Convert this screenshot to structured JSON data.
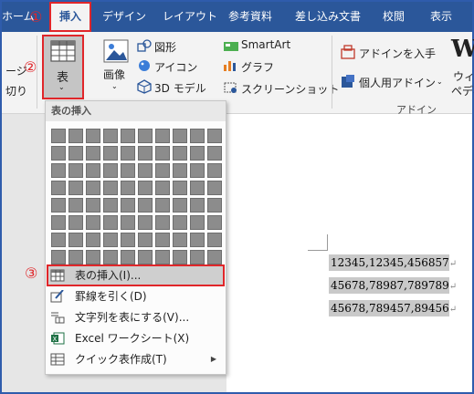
{
  "tabs": [
    {
      "label": "ホーム"
    },
    {
      "label": "挿入",
      "active": true
    },
    {
      "label": "デザイン"
    },
    {
      "label": "レイアウト"
    },
    {
      "label": "参考資料"
    },
    {
      "label": "差し込み文書"
    },
    {
      "label": "校閲"
    },
    {
      "label": "表示"
    }
  ],
  "markers": {
    "one": "①",
    "two": "②",
    "three": "③"
  },
  "ribbon": {
    "left_partial_1": "ージ",
    "left_partial_2": "切り",
    "table_label": "表",
    "image_label": "画像",
    "shapes_label": "図形",
    "icons_label": "アイコン",
    "model3d_label": "3D モデル",
    "smartart_label": "SmartArt",
    "graph_label": "グラフ",
    "screenshot_label": "スクリーンショット",
    "addin_get_label": "アドインを入手",
    "personal_addin_label": "個人用アドイン",
    "wiki_label_1": "ウィキ",
    "wiki_label_2": "ペディ",
    "addins_group_label": "アドイン",
    "wiki_logo": "W"
  },
  "dropdown": {
    "header": "表の挿入",
    "grid_rows": 8,
    "grid_cols": 10,
    "items": [
      {
        "label": "表の挿入(I)...",
        "icon": "table-icon"
      },
      {
        "label": "罫線を引く(D)",
        "icon": "draw-table-icon"
      },
      {
        "label": "文字列を表にする(V)...",
        "icon": "convert-text-icon"
      },
      {
        "label": "Excel ワークシート(X)",
        "icon": "excel-icon"
      },
      {
        "label": "クイック表作成(T)",
        "icon": "quick-table-icon",
        "submenu": true
      }
    ],
    "submenu_arrow": "▶"
  },
  "document": {
    "lines": [
      "12345,12345,456857",
      "45678,78987,789789",
      "45678,789457,89456"
    ],
    "paragraph_mark": "↵"
  },
  "colors": {
    "accent_blue": "#2b579a",
    "highlight_red": "#e0262a",
    "grid_cell": "#8c8c8c"
  }
}
